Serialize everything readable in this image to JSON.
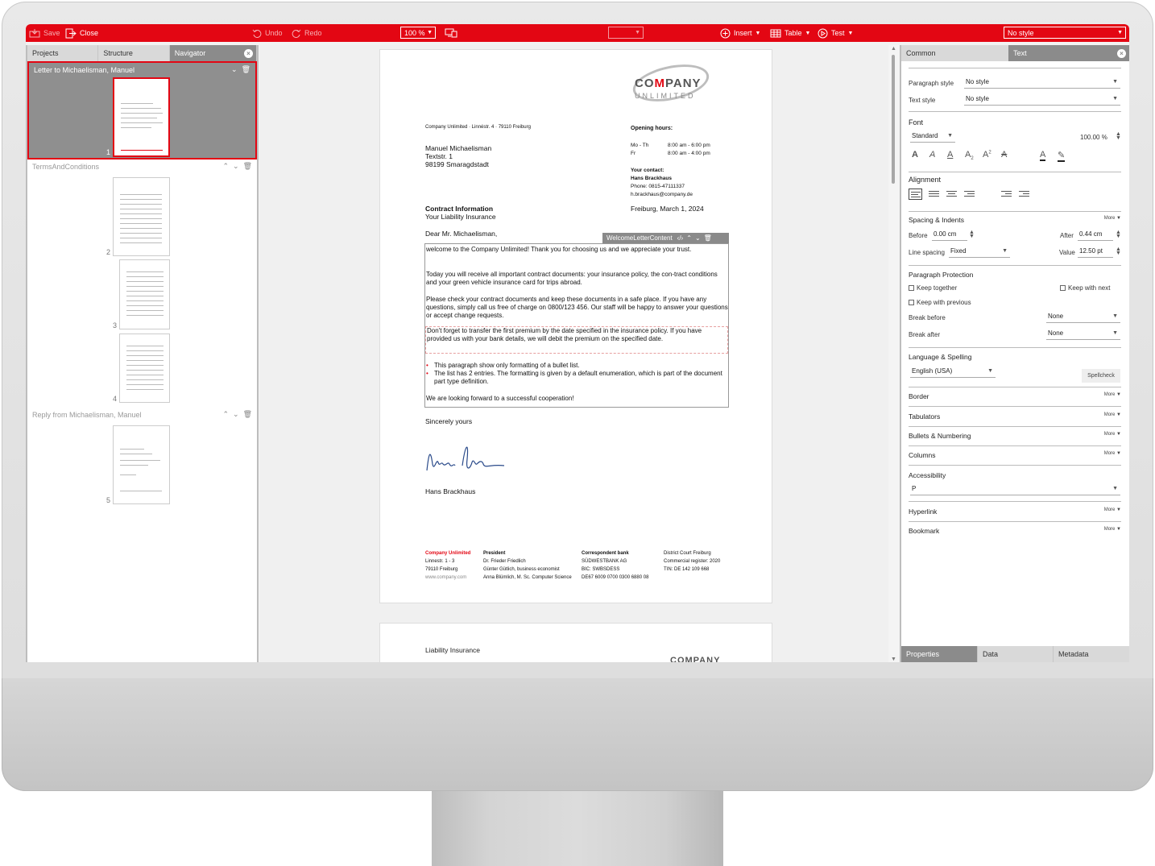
{
  "toolbar": {
    "save": "Save",
    "close": "Close",
    "undo": "Undo",
    "redo": "Redo",
    "zoom": "100 %",
    "insert": "Insert",
    "table": "Table",
    "test": "Test",
    "style": "No style"
  },
  "left_panel": {
    "tabs": [
      "Projects",
      "Structure",
      "Navigator"
    ],
    "groups": [
      {
        "title": "Letter to Michaelisman, Manuel",
        "pages": [
          "1"
        ]
      },
      {
        "title": "TermsAndConditions",
        "pages": [
          "2",
          "3",
          "4"
        ]
      },
      {
        "title": "Reply from Michaelisman, Manuel",
        "pages": [
          "5"
        ]
      }
    ]
  },
  "document": {
    "logo_top_a": "CO",
    "logo_top_m": "M",
    "logo_top_b": "PANY",
    "logo_bottom": "UNLIMITED",
    "sender_line": "Company Unlimited · Linnéstr. 4 · 79110 Freiburg",
    "recipient": [
      "Manuel Michaelisman",
      "Textstr. 1",
      "98199 Smaragdstadt"
    ],
    "opening_hours_title": "Opening hours:",
    "opening_hours": [
      {
        "days": "Mo - Th",
        "hours": "8:00 am - 6:00 pm"
      },
      {
        "days": "Fr",
        "hours": "8:00 am - 4:00 pm"
      }
    ],
    "contact_title": "Your contact:",
    "contact_name": "Hans Brackhaus",
    "contact_phone": "Phone: 0815-47111337",
    "contact_email": "h.brackhaus@company.de",
    "subject": "Contract Information",
    "subject_sub": "Your Liability Insurance",
    "place_date": "Freiburg, March 1, 2024",
    "salutation": "Dear Mr. Michaelisman,",
    "content_label": "WelcomeLetterContent",
    "paragraphs": [
      "welcome to the Company Unlimited! Thank you for choosing us and we appreciate your trust.",
      "Today you will receive all important contract documents: your insurance policy, the con-tract conditions and your green vehicle insurance card for trips abroad.",
      "Please check your contract documents and keep these documents in a safe place. If you have any questions, simply call us free of charge on 0800/123 456. Our staff will be happy to answer your questions or accept change requests.",
      "Don't forget to transfer the first premium by the date specified in the insurance policy. If you have provided us with your bank details, we will debit the premium on the specified date."
    ],
    "bullets": [
      "This paragraph show only formatting of a bullet list.",
      "The list has 2 entries. The formatting is given by a default enumeration, which is part of the document part type definition."
    ],
    "closing_para": "We are looking forward to a successful cooperation!",
    "closing": "Sincerely yours",
    "signer": "Hans Brackhaus",
    "footer": {
      "col1": [
        "Company Unlimited",
        "Linnestr. 1 - 3",
        "79110 Freiburg",
        "www.company.com"
      ],
      "col2": [
        "President",
        "Dr. Frieder Friedlich",
        "Günter Gütlich, business economist",
        "Anna Blümlich, M. Sc. Computer Science"
      ],
      "col3": [
        "Correspondent bank",
        "SÜDWESTBANK AG",
        "BIC: SWBSDESS",
        "DE67 6009 0700 0300 6880 08"
      ],
      "col4": [
        "District Court Freiburg",
        "Commercial register: 2020",
        "TIN: DE 142 109 668"
      ]
    },
    "page2_title": "Liability Insurance",
    "page2_logo": "COMPANY"
  },
  "right_panel": {
    "tabs": [
      "Common",
      "Text"
    ],
    "paragraph_style_label": "Paragraph style",
    "paragraph_style_value": "No style",
    "text_style_label": "Text style",
    "text_style_value": "No style",
    "font_title": "Font",
    "font_value": "Standard",
    "font_scale": "100.00 %",
    "alignment_title": "Alignment",
    "spacing_title": "Spacing & Indents",
    "more": "More ▼",
    "before_label": "Before",
    "before_value": "0.00 cm",
    "after_label": "After",
    "after_value": "0.44 cm",
    "line_spacing_label": "Line spacing",
    "line_spacing_value": "Fixed",
    "value_label": "Value",
    "value_value": "12.50 pt",
    "protection_title": "Paragraph Protection",
    "keep_together": "Keep together",
    "keep_with_next": "Keep with next",
    "keep_with_previous": "Keep with previous",
    "break_before_label": "Break before",
    "break_before_value": "None",
    "break_after_label": "Break after",
    "break_after_value": "None",
    "language_title": "Language & Spelling",
    "language_value": "English (USA)",
    "spellcheck": "Spellcheck",
    "border": "Border",
    "tabulators": "Tabulators",
    "bullets_numbering": "Bullets & Numbering",
    "columns": "Columns",
    "accessibility": "Accessibility",
    "accessibility_value": "P",
    "hyperlink": "Hyperlink",
    "bookmark": "Bookmark",
    "bottom_tabs": [
      "Properties",
      "Data",
      "Metadata"
    ]
  },
  "colors": {
    "accent": "#e30613"
  }
}
